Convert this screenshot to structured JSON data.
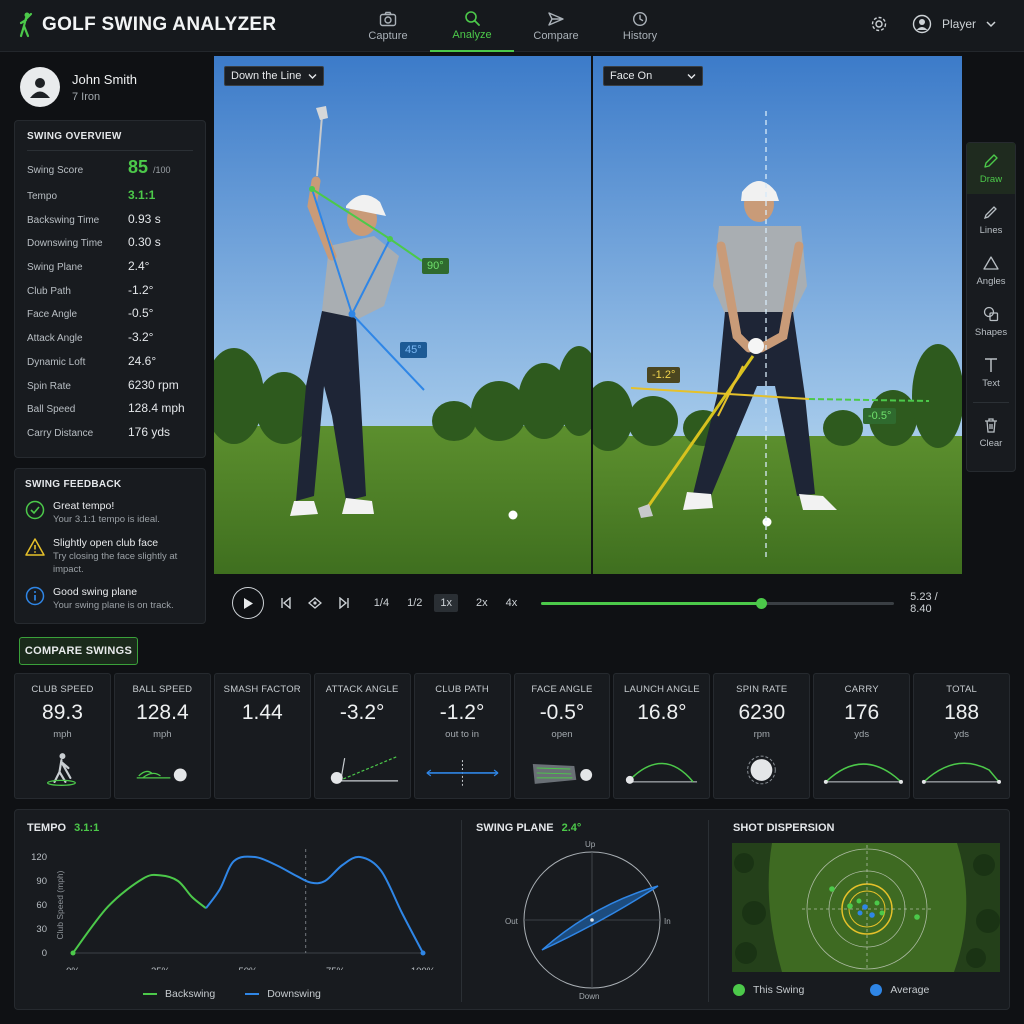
{
  "app": {
    "title": "GOLF SWING ANALYZER"
  },
  "nav": {
    "items": [
      {
        "label": "Capture",
        "icon": "camera-icon"
      },
      {
        "label": "Analyze",
        "icon": "search-icon"
      },
      {
        "label": "Compare",
        "icon": "send-icon"
      },
      {
        "label": "History",
        "icon": "history-icon"
      }
    ],
    "active": "Analyze"
  },
  "user": {
    "menu_label": "Player"
  },
  "profile": {
    "name": "John Smith",
    "club": "7 Iron"
  },
  "overview": {
    "title": "SWING OVERVIEW",
    "score": {
      "label": "Swing Score",
      "value": "85",
      "unit": "/100"
    },
    "tempo": {
      "label": "Tempo",
      "value": "3.1:1"
    },
    "rows": [
      {
        "label": "Backswing Time",
        "value": "0.93 s"
      },
      {
        "label": "Downswing Time",
        "value": "0.30 s"
      },
      {
        "label": "Swing Plane",
        "value": "2.4°"
      },
      {
        "label": "Club Path",
        "value": "-1.2°"
      },
      {
        "label": "Face Angle",
        "value": "-0.5°"
      },
      {
        "label": "Attack Angle",
        "value": "-3.2°"
      },
      {
        "label": "Dynamic Loft",
        "value": "24.6°"
      },
      {
        "label": "Spin Rate",
        "value": "6230 rpm"
      },
      {
        "label": "Ball Speed",
        "value": "128.4 mph"
      },
      {
        "label": "Carry Distance",
        "value": "176 yds"
      }
    ]
  },
  "feedback": {
    "title": "SWING FEEDBACK",
    "items": [
      {
        "title": "Great tempo!",
        "desc": "Your 3.1:1 tempo is ideal.",
        "icon": "check-circle-icon"
      },
      {
        "title": "Slightly open club face",
        "desc": "Try closing the face slightly at impact.",
        "icon": "warning-icon"
      },
      {
        "title": "Good swing plane",
        "desc": "Your swing plane is on track.",
        "icon": "info-icon"
      }
    ]
  },
  "video": {
    "left": {
      "view": "Down the Line",
      "angles": [
        "90°",
        "45°"
      ]
    },
    "right": {
      "view": "Face On",
      "angles": [
        "-1.2°",
        "-0.5°"
      ]
    }
  },
  "tools": [
    {
      "label": "Draw",
      "icon": "pencil-icon"
    },
    {
      "label": "Lines",
      "icon": "line-icon"
    },
    {
      "label": "Angles",
      "icon": "triangle-icon"
    },
    {
      "label": "Shapes",
      "icon": "shapes-icon"
    },
    {
      "label": "Text",
      "icon": "text-icon"
    },
    {
      "label": "Clear",
      "icon": "trash-icon"
    }
  ],
  "playback": {
    "speeds": [
      "1/4",
      "1/2",
      "1x",
      "2x",
      "4x"
    ],
    "active_speed": "1x",
    "time": "5.23 / 8.40",
    "progress": 0.623
  },
  "compare_button": "COMPARE SWINGS",
  "metrics": [
    {
      "label": "CLUB SPEED",
      "value": "89.3",
      "unit": "mph"
    },
    {
      "label": "BALL SPEED",
      "value": "128.4",
      "unit": "mph"
    },
    {
      "label": "SMASH FACTOR",
      "value": "1.44",
      "unit": ""
    },
    {
      "label": "ATTACK ANGLE",
      "value": "-3.2°",
      "unit": ""
    },
    {
      "label": "CLUB PATH",
      "value": "-1.2°",
      "unit": "out to in"
    },
    {
      "label": "FACE ANGLE",
      "value": "-0.5°",
      "unit": "open"
    },
    {
      "label": "LAUNCH ANGLE",
      "value": "16.8°",
      "unit": ""
    },
    {
      "label": "SPIN RATE",
      "value": "6230",
      "unit": "rpm"
    },
    {
      "label": "CARRY",
      "value": "176",
      "unit": "yds"
    },
    {
      "label": "TOTAL",
      "value": "188",
      "unit": "yds"
    }
  ],
  "tempo_panel": {
    "title": "TEMPO",
    "value": "3.1:1",
    "legend": [
      "Backswing",
      "Downswing"
    ]
  },
  "plane_panel": {
    "title": "SWING PLANE",
    "value": "2.4°",
    "labels": {
      "top": "Up",
      "bottom": "Down",
      "left": "Out",
      "right": "In"
    }
  },
  "dispersion_panel": {
    "title": "SHOT DISPERSION",
    "legend": [
      "This Swing",
      "Average"
    ]
  },
  "colors": {
    "accent": "#4cc94a",
    "blue": "#2f86e6",
    "yellow": "#e6c12a"
  },
  "chart_data": {
    "type": "line",
    "ylabel": "Club Speed (mph)",
    "ylim": [
      0,
      120
    ],
    "y_ticks": [
      "120",
      "90",
      "60",
      "30",
      "0"
    ],
    "x_ticks": [
      "0%",
      "25%",
      "50%",
      "75%",
      "100%"
    ],
    "grid": false,
    "legend_position": "bottom",
    "series": [
      {
        "name": "Backswing",
        "x": [
          0,
          10,
          20,
          25,
          30,
          34,
          38
        ],
        "y": [
          0,
          58,
          93,
          97,
          90,
          70,
          56
        ]
      },
      {
        "name": "Downswing",
        "x": [
          38,
          42,
          46,
          52,
          58,
          64,
          68,
          72,
          77,
          82,
          88,
          94,
          100
        ],
        "y": [
          56,
          80,
          115,
          120,
          110,
          96,
          88,
          90,
          110,
          120,
          103,
          50,
          0
        ]
      }
    ]
  }
}
